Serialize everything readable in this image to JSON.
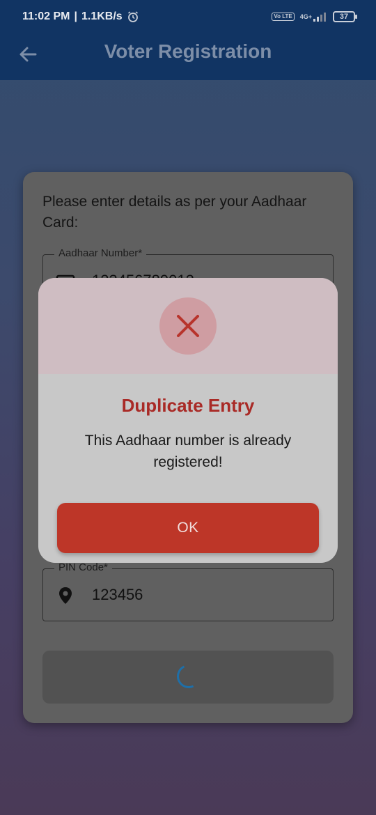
{
  "status_bar": {
    "time": "11:02 PM",
    "speed": "1.1KB/s",
    "alarm_icon": "alarm-icon",
    "volte": "Vo LTE",
    "network": "4G+",
    "battery": "37"
  },
  "app_bar": {
    "title": "Voter Registration",
    "back_icon": "back-arrow-icon"
  },
  "form": {
    "intro": "Please enter details as per your Aadhaar Card:",
    "aadhaar_label": "Aadhaar Number*",
    "aadhaar_value": "123456789012",
    "pin_label": "PIN Code*",
    "pin_value": "123456",
    "pin_icon": "location-pin-icon",
    "card_icon": "card-icon"
  },
  "dialog": {
    "icon": "close-icon",
    "title": "Duplicate Entry",
    "message": "This Aadhaar number is already registered!",
    "ok_label": "OK"
  },
  "colors": {
    "app_bar": "#113463",
    "dialog_title": "#a92a26",
    "ok_button": "#bd3628",
    "spinner": "#1e6fa8"
  }
}
